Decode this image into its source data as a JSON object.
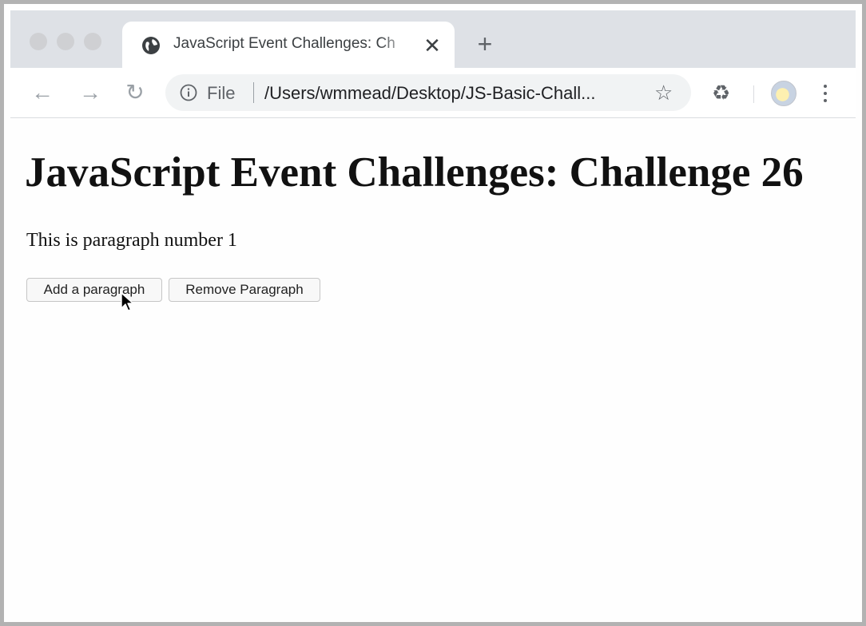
{
  "browser": {
    "tab": {
      "title": "JavaScript Event Challenges: Ch",
      "close_glyph": "✕",
      "icon": "globe-icon"
    },
    "new_tab_glyph": "+",
    "toolbar": {
      "back_glyph": "←",
      "forward_glyph": "→",
      "reload_glyph": "↻",
      "omnibox": {
        "scheme_label": "File",
        "url": "/Users/wmmead/Desktop/JS-Basic-Chall..."
      },
      "bookmark_glyph": "☆",
      "extension_glyph": "♻"
    }
  },
  "page": {
    "heading": "JavaScript Event Challenges: Challenge 26",
    "paragraph": "This is paragraph number 1",
    "buttons": {
      "add": "Add a paragraph",
      "remove": "Remove Paragraph"
    }
  },
  "colors": {
    "tabstrip": "#dee1e6",
    "omnibox": "#f1f3f4",
    "frame_border": "#b2b2b2"
  }
}
